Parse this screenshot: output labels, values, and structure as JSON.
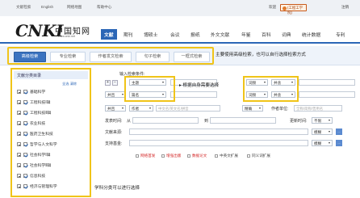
{
  "topbar": {
    "links": [
      "文献检索",
      "English",
      "网络地图",
      "帮助中心"
    ],
    "welcome": "欢迎",
    "user": "(工程工学院)",
    "logout": "注销"
  },
  "logo": {
    "main": "CNKI",
    "cn": "中国知网",
    "url": "www.cnki.net"
  },
  "nav": [
    "文献",
    "期刊",
    "博硕士",
    "会议",
    "报纸",
    "外文文献",
    "年鉴",
    "百科",
    "词典",
    "统计数据",
    "专利"
  ],
  "tabs": [
    "高级检索",
    "专业检索",
    "作者发文检索",
    "句子检索",
    "一框式检索"
  ],
  "annotations": {
    "tabs": "主要使用高级检索，也可以自行选择检索方式",
    "fields": "根据自身需要选择",
    "sidebar": "学科分类可以进行选择"
  },
  "sidebar": {
    "title": "文献分类目录",
    "actions": [
      "全选",
      "清除"
    ],
    "categories": [
      "基础科学",
      "工程科技Ⅰ辑",
      "工程科技Ⅱ辑",
      "农业科技",
      "医药卫生科技",
      "哲学与人文科学",
      "社会科学Ⅰ辑",
      "社会科学Ⅱ辑",
      "信息科技",
      "经济与管理科学"
    ]
  },
  "form": {
    "heading": "输入检索条件:",
    "rows": [
      {
        "field": "主题",
        "freq": "词频",
        "logic2": "并含"
      },
      {
        "logic": "并且",
        "field": "篇名",
        "freq": "词频",
        "logic2": "并含"
      },
      {
        "logic": "并且",
        "field": "作者",
        "author_placeholder": "中文名/英文名/拼音",
        "precision": "精确",
        "org_label": "作者单位:",
        "org_placeholder": "全称/简称/曾用名"
      }
    ],
    "pubtime_label": "发表时间:",
    "from_label": "从",
    "to_label": "到",
    "update_label": "更新时间:",
    "update_value": "不限",
    "source_label": "文献来源:",
    "source_precision": "模糊",
    "fund_label": "支持基金:",
    "fund_precision": "模糊",
    "more": "...",
    "checkboxes": [
      "网络首发",
      "增强出版",
      "数据论文",
      "中英文扩展",
      "同义词扩展"
    ]
  }
}
